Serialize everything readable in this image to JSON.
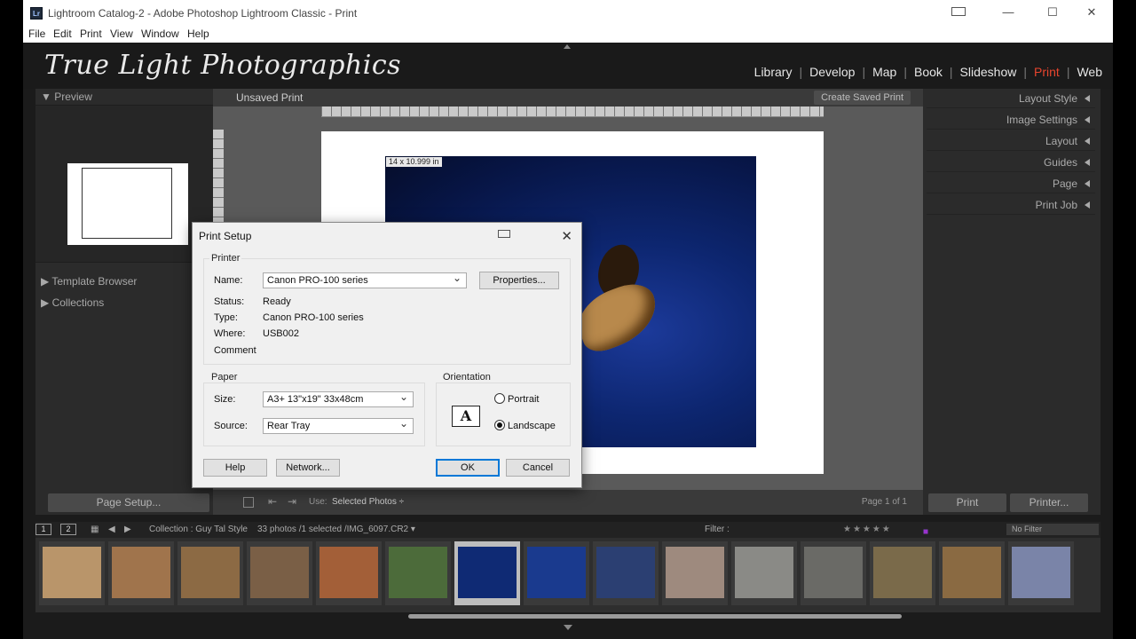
{
  "window": {
    "app_icon": "Lr",
    "title": "Lightroom Catalog-2 - Adobe Photoshop Lightroom Classic - Print",
    "controls": {
      "minimize": "—",
      "maximize": "☐",
      "close": "✕"
    }
  },
  "menu": [
    "File",
    "Edit",
    "Print",
    "View",
    "Window",
    "Help"
  ],
  "identity_plate": "True Light Photographics",
  "modules": [
    "Library",
    "Develop",
    "Map",
    "Book",
    "Slideshow",
    "Print",
    "Web"
  ],
  "active_module": "Print",
  "left_panel": {
    "preview_header": "Preview",
    "template_browser": "Template Browser",
    "collections": "Collections",
    "collections_minus": "–",
    "page_setup_button": "Page Setup..."
  },
  "center": {
    "title": "Unsaved Print",
    "create_saved_print": "Create Saved Print",
    "size_tag": "14 x 10.999 in",
    "use_label": "Use:",
    "use_value": "Selected Photos ÷",
    "page_indicator": "Page 1 of 1"
  },
  "right_panel": {
    "items": [
      "Layout Style",
      "Image Settings",
      "Layout",
      "Guides",
      "Page",
      "Print Job"
    ],
    "print_button": "Print",
    "printer_button": "Printer..."
  },
  "filmstrip": {
    "view1": "1",
    "view2": "2",
    "collection": "Collection : Guy Tal Style",
    "count": "33 photos /1 selected /IMG_6097.CR2 ▾",
    "filter_label": "Filter :",
    "stars": "★★★★★",
    "no_filter": "No Filter",
    "thumb_colors": [
      "#b9956a",
      "#a0744c",
      "#8c6a44",
      "#7a5f46",
      "#a35f38",
      "#4c6b3a",
      "#0f2a74",
      "#1a3a8e",
      "#2b3f72",
      "#9e8a7e",
      "#8a8a86",
      "#6a6a66",
      "#7a6a4a",
      "#8a6a42",
      "#7a84a8"
    ],
    "selected_index": 6
  },
  "dialog": {
    "title": "Print Setup",
    "printer_group": "Printer",
    "name_label": "Name:",
    "name_value": "Canon PRO-100 series",
    "properties_button": "Properties...",
    "status_label": "Status:",
    "status_value": "Ready",
    "type_label": "Type:",
    "type_value": "Canon PRO-100 series",
    "where_label": "Where:",
    "where_value": "USB002",
    "comment_label": "Comment",
    "paper_group": "Paper",
    "size_label": "Size:",
    "size_value": "A3+ 13\"x19\" 33x48cm",
    "source_label": "Source:",
    "source_value": "Rear Tray",
    "orientation_group": "Orientation",
    "orientation_icon": "A",
    "portrait_label": "Portrait",
    "landscape_label": "Landscape",
    "orientation_selected": "Landscape",
    "help_button": "Help",
    "network_button": "Network...",
    "ok_button": "OK",
    "cancel_button": "Cancel",
    "close_glyph": "✕"
  }
}
